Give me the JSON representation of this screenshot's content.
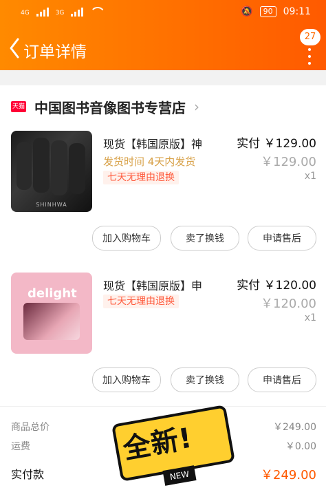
{
  "status": {
    "time": "09:11",
    "battery": "90",
    "sim1": "4G",
    "sim2": "3G"
  },
  "header": {
    "title": "订单详情",
    "badge": "27"
  },
  "shop": {
    "tmall_logo": "天猫",
    "name": "中国图书音像图书专营店"
  },
  "items": [
    {
      "title": "现货【韩国原版】神",
      "shipping": "发货时间 4天内发货",
      "return_tag": "七天无理由退换",
      "paid_label": "实付",
      "paid_value": "￥129.00",
      "original_price": "￥129.00",
      "qty": "x1",
      "cover_label": "SHINHWA"
    },
    {
      "title": "现货【韩国原版】申",
      "return_tag": "七天无理由退换",
      "paid_label": "实付",
      "paid_value": "￥120.00",
      "original_price": "￥120.00",
      "qty": "x1",
      "cover_title": "delight"
    }
  ],
  "actions": [
    "加入购物车",
    "卖了换钱",
    "申请售后"
  ],
  "summary": {
    "goods_total_label": "商品总价",
    "goods_total_value": "￥249.00",
    "shipping_label": "运费",
    "shipping_value": "￥0.00",
    "paid_label": "实付款",
    "paid_value": "￥249.00"
  },
  "sticker": {
    "text": "全新!",
    "badge": "NEW"
  },
  "colors": {
    "orange_start": "#ff8a00",
    "orange_end": "#ff5a00",
    "tag_red": "#ff5a3c"
  }
}
